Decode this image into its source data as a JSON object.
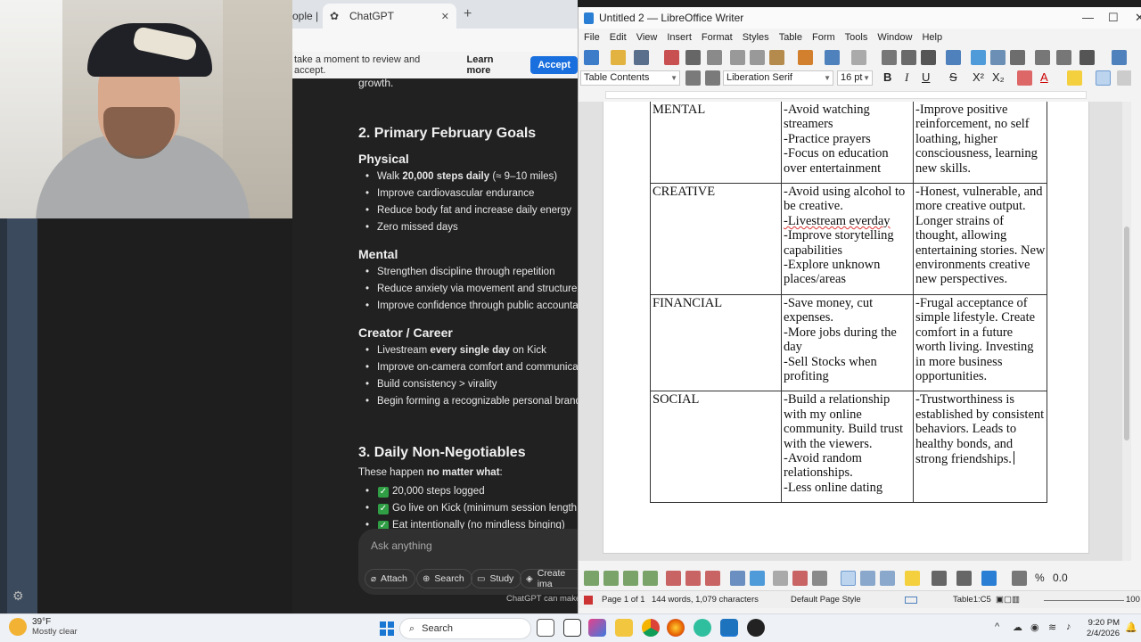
{
  "browser": {
    "tabs": {
      "prev_label": "ople |",
      "active_label": "ChatGPT"
    },
    "cookie": {
      "text": "take a moment to review and accept.",
      "learn_more": "Learn more",
      "accept": "Accept"
    },
    "chat": {
      "top_text": "growth.",
      "section2_title": "2. Primary February Goals",
      "physical_title": "Physical",
      "physical_items": [
        "Walk ",
        "20,000 steps daily",
        " (≈ 9–10 miles)",
        "Improve cardiovascular endurance",
        "Reduce body fat and increase daily energy",
        "Zero missed days"
      ],
      "mental_title": "Mental",
      "mental_items": [
        "Strengthen discipline through repetition",
        "Reduce anxiety via movement and structure",
        "Improve confidence through public accountabili"
      ],
      "creator_title": "Creator / Career",
      "creator_items": [
        "Livestream ",
        "every single day",
        " on Kick",
        "Improve on-camera comfort and communicatio",
        "Build consistency > virality",
        "Begin forming a recognizable personal brand"
      ],
      "section3_title": "3. Daily Non-Negotiables",
      "section3_intro_a": "These happen ",
      "section3_intro_b": "no matter what",
      "section3_intro_c": ":",
      "nonneg_items": [
        "20,000 steps logged",
        "Go live on Kick (minimum session length yo",
        "Eat intentionally (no mindless binging)"
      ],
      "composer_placeholder": "Ask anything",
      "composer_buttons": [
        "Attach",
        "Search",
        "Study",
        "Create ima"
      ],
      "footnote": "ChatGPT can make mis"
    }
  },
  "writer": {
    "window_title": "Untitled 2 — LibreOffice Writer",
    "menu": [
      "File",
      "Edit",
      "View",
      "Insert",
      "Format",
      "Styles",
      "Table",
      "Form",
      "Tools",
      "Window",
      "Help"
    ],
    "paragraph_style": "Table Contents",
    "font_name": "Liberation Serif",
    "font_size": "16 pt",
    "table": [
      {
        "category": "MENTAL",
        "actions": [
          "-Avoid watching",
          "streamers",
          "-Practice prayers",
          "-Focus on education",
          "over entertainment"
        ],
        "outcomes": [
          "-Improve positive",
          "reinforcement, no self",
          "loathing, higher",
          "consciousness, learning",
          "new skills."
        ]
      },
      {
        "category": "CREATIVE",
        "actions": [
          "-Avoid using alcohol to",
          "be creative.",
          "-Livestream everday",
          "-Improve storytelling",
          "capabilities",
          "-Explore unknown",
          "places/areas"
        ],
        "outcomes": [
          "-Honest, vulnerable, and",
          "more creative output.",
          "Longer strains of",
          "thought, allowing",
          "entertaining stories. New",
          "environments creative",
          "new perspectives."
        ]
      },
      {
        "category": "FINANCIAL",
        "actions": [
          "-Save money, cut",
          "expenses.",
          "-More jobs during the",
          "day",
          "-Sell Stocks when",
          "profiting"
        ],
        "outcomes": [
          "-Frugal acceptance of",
          "simple lifestyle. Create",
          "comfort in a future",
          "worth living. Investing",
          "in more business",
          "opportunities."
        ]
      },
      {
        "category": "SOCIAL",
        "actions": [
          "-Build a relationship",
          "with my online",
          "community. Build trust",
          "with the viewers.",
          "-Avoid random",
          "relationships.",
          "-Less online dating"
        ],
        "outcomes": [
          "-Trustworthiness is",
          "established by consistent",
          "behaviors. Leads to",
          "healthy bonds, and",
          "strong friendships."
        ]
      }
    ],
    "status": {
      "page": "Page 1 of 1",
      "words": "144 words, 1,079 characters",
      "page_style": "Default Page Style",
      "cell": "Table1:C5",
      "zoom": "100"
    }
  },
  "taskbar": {
    "temperature": "39°F",
    "condition": "Mostly clear",
    "search_label": "Search",
    "time": "9:20 PM",
    "date": "2/4/2026"
  }
}
